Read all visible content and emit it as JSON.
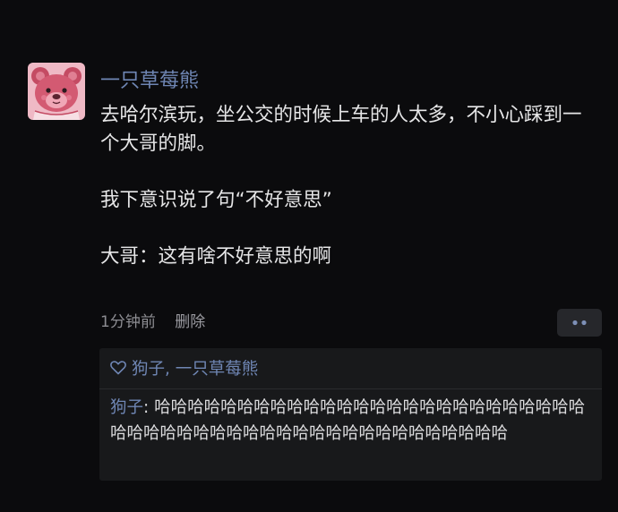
{
  "post": {
    "username": "一只草莓熊",
    "paragraphs": [
      "去哈尔滨玩，坐公交的时候上车的人太多，不小心踩到一个大哥的脚。",
      "我下意识说了句“不好意思”",
      "大哥：这有啥不好意思的啊"
    ],
    "time": "1分钟前",
    "delete_label": "删除",
    "avatar_icon": "strawberry-bear-avatar",
    "more_icon": "more-dots-icon"
  },
  "interactions": {
    "likes_text": "狗子, 一只草莓熊",
    "like_icon": "heart-icon",
    "comment": {
      "author": "狗子",
      "separator": ": ",
      "text": "哈哈哈哈哈哈哈哈哈哈哈哈哈哈哈哈哈哈哈哈哈哈哈哈哈哈哈哈哈哈哈哈哈哈哈哈哈哈哈哈哈哈哈哈哈哈哈哈哈哈"
    }
  },
  "colors": {
    "background": "#0b0b0d",
    "link_blue": "#6f86b4",
    "panel": "#18191b"
  }
}
